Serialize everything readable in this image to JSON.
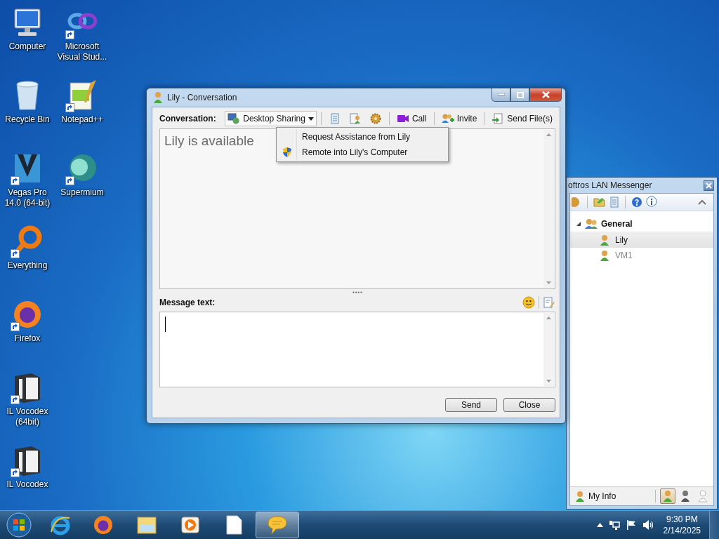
{
  "desktop_icon_rows": [
    {
      "icons": [
        {
          "label": "Computer",
          "kind": "computer",
          "shortcut": false
        },
        {
          "label": "Microsoft Visual Stud...",
          "kind": "vs",
          "shortcut": true
        }
      ]
    },
    {
      "icons": [
        {
          "label": "Recycle Bin",
          "kind": "recycle",
          "shortcut": false
        },
        {
          "label": "Notepad++",
          "kind": "notepad",
          "shortcut": true
        }
      ]
    },
    {
      "icons": [
        {
          "label": "Vegas Pro 14.0 (64-bit)",
          "kind": "vegas",
          "shortcut": true
        },
        {
          "label": "Supermium",
          "kind": "supermium",
          "shortcut": true
        }
      ]
    },
    {
      "icons": [
        {
          "label": "Everything",
          "kind": "everything",
          "shortcut": true
        }
      ]
    },
    {
      "icons": [
        {
          "label": "Firefox",
          "kind": "firefox",
          "shortcut": true
        }
      ]
    },
    {
      "icons": [
        {
          "label": "IL Vocodex (64bit)",
          "kind": "vocodex",
          "shortcut": true
        }
      ]
    },
    {
      "icons": [
        {
          "label": "IL Vocodex",
          "kind": "vocodex",
          "shortcut": true
        }
      ]
    }
  ],
  "conversation_window": {
    "title": "Lily - Conversation",
    "toolbar_label": "Conversation:",
    "toolbar": [
      {
        "kind": "sharing",
        "label": "Desktop Sharing",
        "expanded": true
      },
      {
        "kind": "history"
      },
      {
        "kind": "contact"
      },
      {
        "kind": "gear"
      },
      {
        "kind": "call",
        "label": "Call"
      },
      {
        "kind": "invite",
        "label": "Invite"
      },
      {
        "kind": "file",
        "label": "Send File(s)"
      }
    ],
    "sharing_menu": [
      {
        "label": "Request Assistance from Lily",
        "kind": "plain"
      },
      {
        "label": "Remote into Lily's Computer",
        "kind": "shield"
      }
    ],
    "status_message": "Lily is available",
    "message_label": "Message text:",
    "buttons": [
      "Send",
      "Close"
    ]
  },
  "messenger_window": {
    "title": "oftros LAN Messenger",
    "groups": [
      {
        "name": "General",
        "expanded": true,
        "children": [
          {
            "name": "Lily",
            "selected": true,
            "online": true
          },
          {
            "name": "VM1",
            "selected": false,
            "online": false
          }
        ]
      }
    ],
    "my_info": "My Info",
    "statuses": [
      {
        "kind": "available",
        "selected": true
      },
      {
        "kind": "busy",
        "selected": false
      },
      {
        "kind": "offline",
        "selected": false
      }
    ]
  },
  "taskbar": {
    "pinned": [
      {
        "kind": "ie",
        "active": false
      },
      {
        "kind": "firefox",
        "active": false
      },
      {
        "kind": "explorer",
        "active": false
      },
      {
        "kind": "media",
        "active": false
      },
      {
        "kind": "document",
        "active": false
      },
      {
        "kind": "messenger",
        "active": true
      }
    ],
    "time": "9:30 PM",
    "date": "2/14/2025"
  }
}
